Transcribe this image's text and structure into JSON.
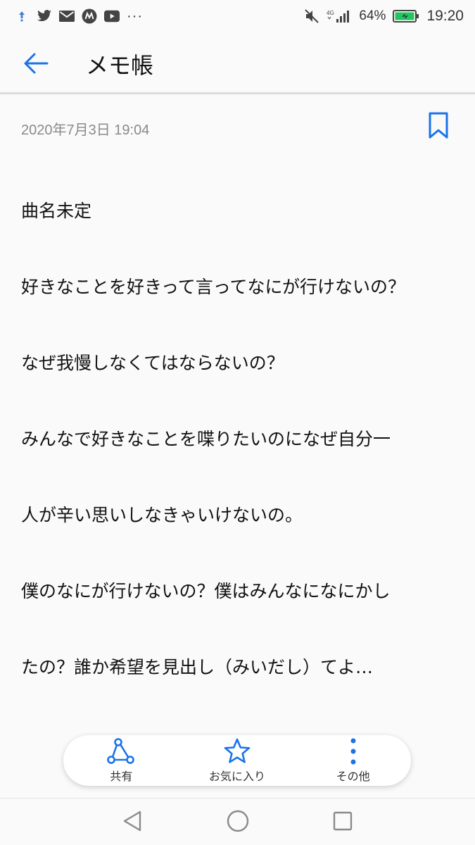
{
  "status_bar": {
    "notification_icons": [
      "upload-arrow-icon",
      "twitter-icon",
      "mail-icon",
      "m-circle-icon",
      "youtube-icon"
    ],
    "more_indicator": "···",
    "network": "4G",
    "battery_percent": "64%",
    "time": "19:20"
  },
  "app_bar": {
    "title": "メモ帳"
  },
  "note": {
    "date": "2020年7月3日 19:04",
    "lines": [
      "曲名未定",
      "好きなことを好きって言ってなにが行けないの？",
      "なぜ我慢しなくてはならないの？",
      "みんなで好きなことを喋りたいのになぜ自分一",
      "人が辛い思いしなきゃいけないの。",
      "僕のなにが行けないの？僕はみんなになにかし",
      "たの？誰か希望を見出し（みいだし）てよ…"
    ]
  },
  "actions": {
    "share_label": "共有",
    "favorite_label": "お気に入り",
    "more_label": "その他"
  },
  "colors": {
    "accent": "#1a73e8",
    "text": "#111111",
    "meta": "#8a8a8a",
    "background": "#fafafa",
    "battery": "#22c55e"
  }
}
